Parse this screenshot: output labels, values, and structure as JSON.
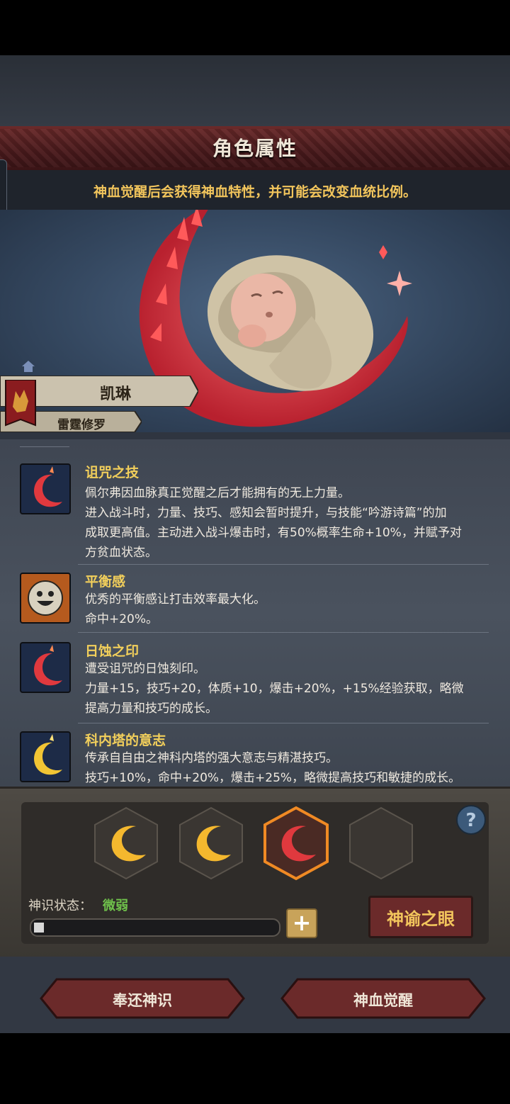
{
  "header": {
    "title": "角色属性"
  },
  "hint": "神血觉醒后会获得神血特性，并可能会改变血统比例。",
  "character": {
    "name": "凯琳",
    "class": "雷霆修罗"
  },
  "traits": [
    {
      "name": "诅咒之技",
      "icon": "red-crescent-icon",
      "lines": [
        "佩尔弗因血脉真正觉醒之后才能拥有的无上力量。",
        "进入战斗时，力量、技巧、感知会暂时提升，与技能“吟游诗篇”的加",
        "成取更高值。主动进入战斗爆击时，有50%概率生命+10%，并赋予对",
        "方贫血状态。"
      ]
    },
    {
      "name": "平衡感",
      "icon": "smiley-face-icon",
      "lines": [
        "优秀的平衡感让打击效率最大化。",
        "命中+20%。"
      ]
    },
    {
      "name": "日蚀之印",
      "icon": "red-crescent-icon",
      "lines": [
        "遭受诅咒的日蚀刻印。",
        "力量+15，技巧+20，体质+10，爆击+20%，+15%经验获取，略微",
        "提高力量和技巧的成长。"
      ]
    },
    {
      "name": "科内塔的意志",
      "icon": "gold-crescent-icon",
      "lines": [
        "传承自自由之神科内塔的强大意志与精湛技巧。",
        "技巧+10%，命中+20%，爆击+25%，略微提高技巧和敏捷的成长。"
      ]
    }
  ],
  "slots": [
    {
      "kind": "gold-crescent"
    },
    {
      "kind": "gold-crescent"
    },
    {
      "kind": "red-crescent",
      "selected": true
    },
    {
      "kind": "empty"
    }
  ],
  "divine": {
    "state_label": "神识状态：",
    "state_value": "微弱",
    "progress": 0.04
  },
  "buttons": {
    "oracle": "神谕之眼",
    "help": "?",
    "plus": "+",
    "return": "奉还神识",
    "awaken": "神血觉醒"
  },
  "colors": {
    "accent_gold": "#f2cf5b",
    "state_green": "#6fc14b",
    "crimson": "#e0393e"
  }
}
